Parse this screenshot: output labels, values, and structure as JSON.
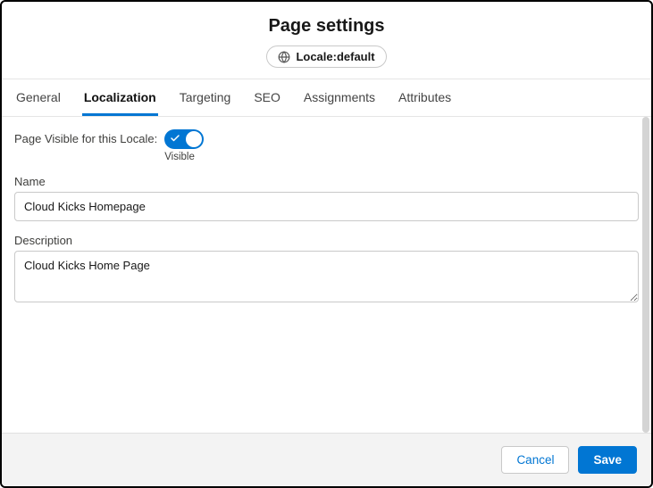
{
  "header": {
    "title": "Page settings",
    "locale_label": "Locale:default"
  },
  "tabs": {
    "general": "General",
    "localization": "Localization",
    "targeting": "Targeting",
    "seo": "SEO",
    "assignments": "Assignments",
    "attributes": "Attributes"
  },
  "form": {
    "visible_label": "Page Visible for this Locale:",
    "visible_status": "Visible",
    "name_label": "Name",
    "name_value": "Cloud Kicks Homepage",
    "description_label": "Description",
    "description_value": "Cloud Kicks Home Page"
  },
  "footer": {
    "cancel": "Cancel",
    "save": "Save"
  }
}
